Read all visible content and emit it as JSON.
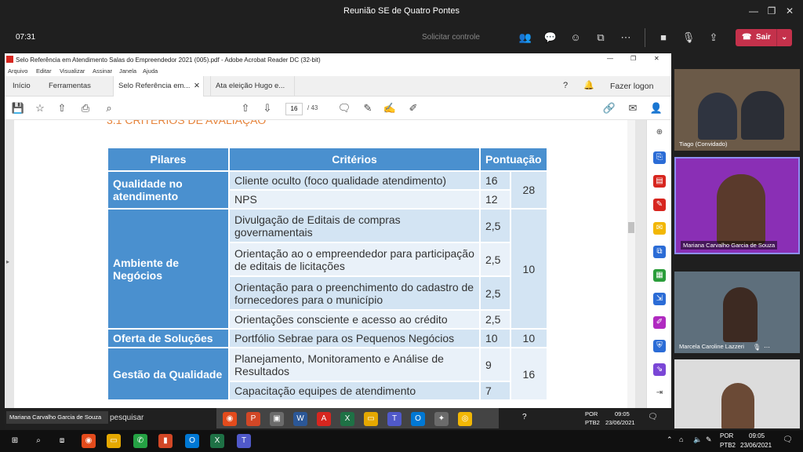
{
  "teams": {
    "window_title": "Reunião SE de Quatro Pontes",
    "meeting_time": "07:31",
    "request_control": "Solicitar controle",
    "leave_label": "Sair"
  },
  "acrobat": {
    "window_title": "Selo Referência em Atendimento Salas do Empreendedor 2021 (005).pdf - Adobe Acrobat Reader DC (32-bit)",
    "menu": [
      "Arquivo",
      "Editar",
      "Visualizar",
      "Assinar",
      "Janela",
      "Ajuda"
    ],
    "tabs": [
      "Início",
      "Ferramentas",
      "Selo Referência em...",
      "Ata eleição Hugo e..."
    ],
    "login": "Fazer logon",
    "page_current": "16",
    "page_total": "/ 43",
    "section_heading": "3.1 CRITÉRIOS DE AVALIAÇÃO"
  },
  "pdf_table": {
    "headers": [
      "Pilares",
      "Critérios",
      "Pontuação"
    ],
    "pillars": [
      {
        "name": "Qualidade no atendimento",
        "total": "28",
        "rows": [
          {
            "c": "Cliente oculto (foco qualidade atendimento)",
            "p": "16"
          },
          {
            "c": "NPS",
            "p": "12"
          }
        ]
      },
      {
        "name": "Ambiente de Negócios",
        "total": "10",
        "rows": [
          {
            "c": "Divulgação de Editais de compras governamentais",
            "p": "2,5"
          },
          {
            "c": "Orientação ao o empreendedor para participação de editais de licitações",
            "p": "2,5"
          },
          {
            "c": "Orientação para o preenchimento do cadastro de fornecedores para o município",
            "p": "2,5"
          },
          {
            "c": "Orientações consciente e acesso ao crédito",
            "p": "2,5"
          }
        ]
      },
      {
        "name": "Oferta de Soluções",
        "total": "10",
        "rows": [
          {
            "c": "Portfólio Sebrae para os Pequenos Negócios",
            "p": "10"
          }
        ]
      },
      {
        "name": "Gestão da Qualidade",
        "total": "16",
        "rows": [
          {
            "c": "Planejamento, Monitoramento e Análise de Resultados",
            "p": "9"
          },
          {
            "c": "Capacitação equipes de atendimento",
            "p": "7"
          }
        ]
      }
    ]
  },
  "participants": [
    {
      "name": "Tiago (Convidado)"
    },
    {
      "name": "Mariana Carvalho Garcia de Souza"
    },
    {
      "name": "Marcela Caroline Lazzeri"
    },
    {
      "name": ""
    }
  ],
  "inner_taskbar": {
    "presenter": "Mariana Carvalho Garcia de Souza",
    "search": "pesquisar",
    "lang": "POR",
    "kb": "PTB2",
    "time": "09:05",
    "date": "23/06/2021"
  },
  "taskbar": {
    "lang": "POR",
    "kb": "PTB2",
    "time": "09:05",
    "date": "23/06/2021"
  }
}
